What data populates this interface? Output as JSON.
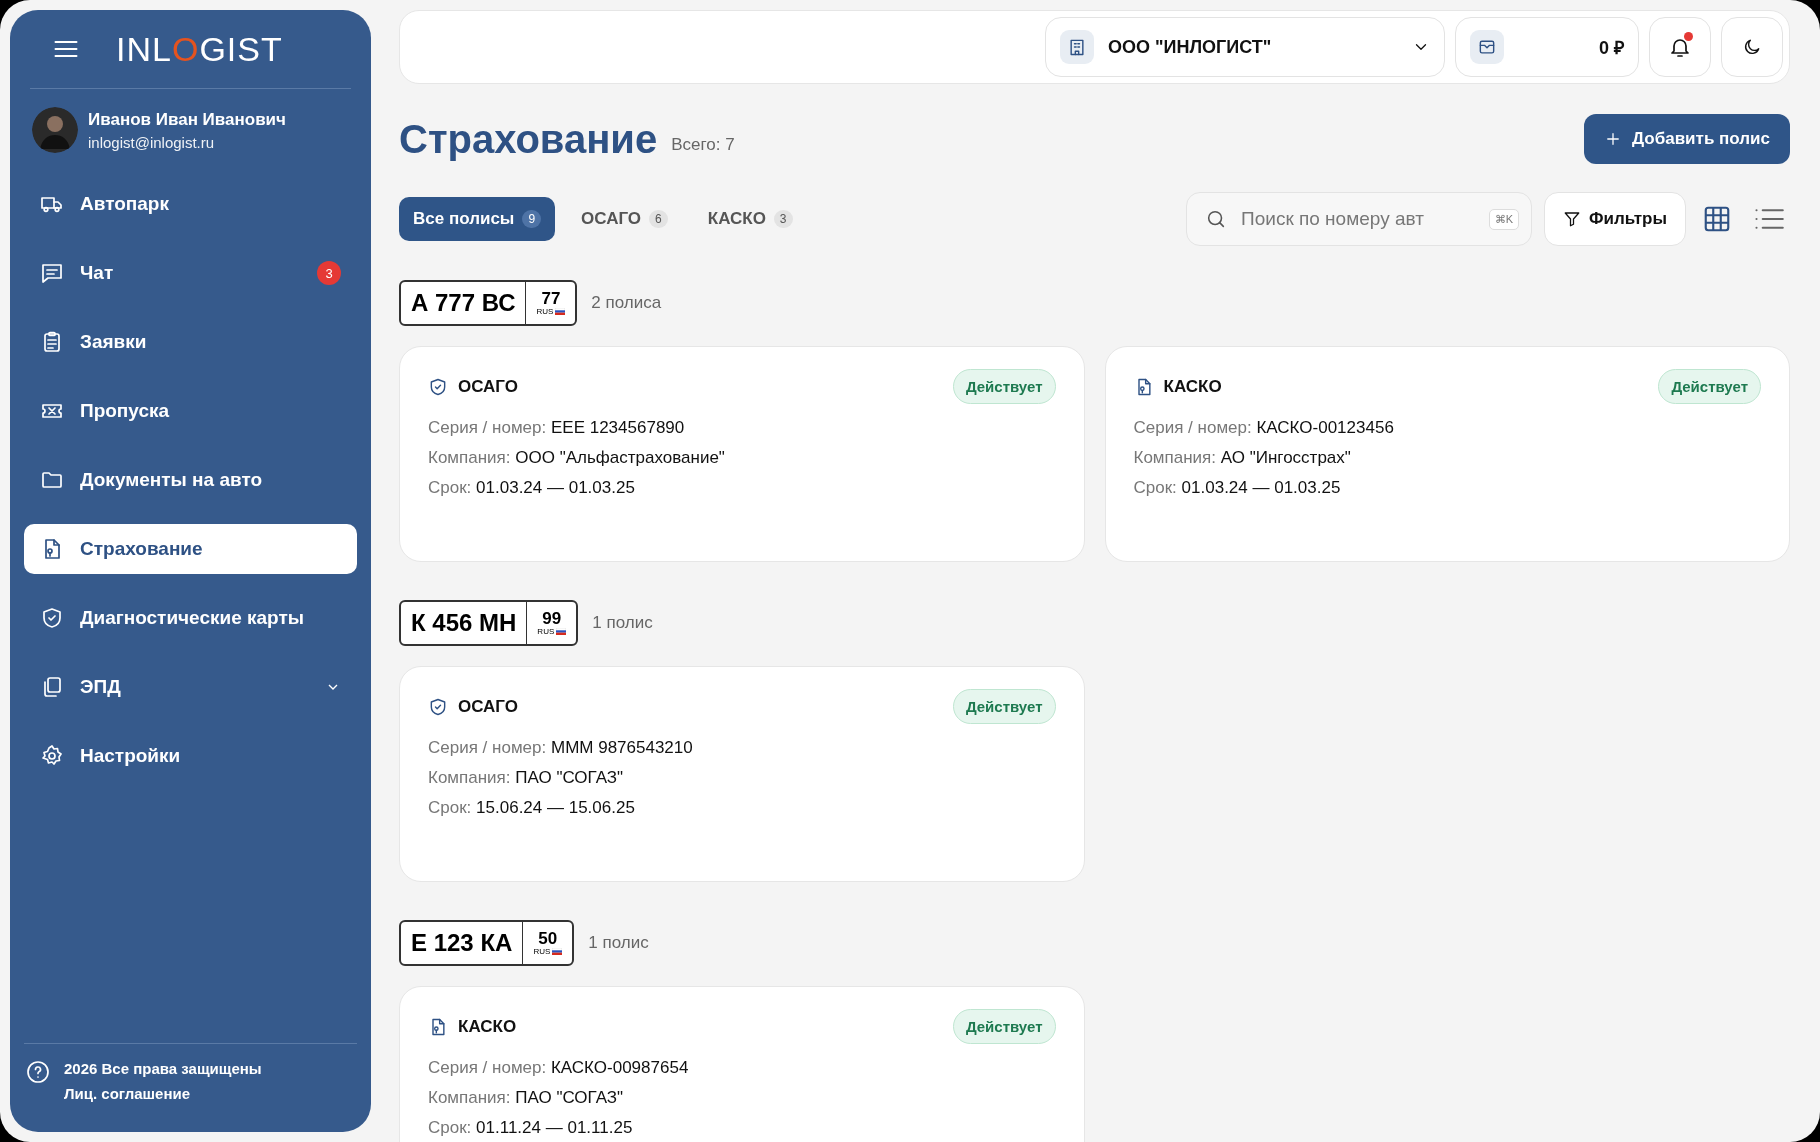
{
  "sidebar": {
    "logo": {
      "before": "INL",
      "accent": "O",
      "after": "GIST"
    },
    "user": {
      "name": "Иванов Иван Иванович",
      "email": "inlogist@inlogist.ru"
    },
    "items": [
      {
        "label": "Автопарк",
        "kind": "truck",
        "selected": false
      },
      {
        "label": "Чат",
        "kind": "chat",
        "selected": false,
        "badge": "3"
      },
      {
        "label": "Заявки",
        "kind": "clipboard",
        "selected": false
      },
      {
        "label": "Пропуска",
        "kind": "ticket",
        "selected": false
      },
      {
        "label": "Документы на авто",
        "kind": "folder",
        "selected": false
      },
      {
        "label": "Страхование",
        "kind": "document",
        "selected": true
      },
      {
        "label": "Диагностические карты",
        "kind": "shield",
        "selected": false
      },
      {
        "label": "ЭПД",
        "kind": "copy",
        "selected": false,
        "expanded": false
      },
      {
        "label": "Настройки",
        "kind": "gear",
        "selected": false
      }
    ],
    "footer": {
      "copyright": "2026 Все права защищены",
      "link": "Лиц. соглашение"
    }
  },
  "topbar": {
    "company": "ООО \"ИНЛОГИСТ\"",
    "balance": "0 ₽",
    "unread": true
  },
  "header": {
    "title": "Страхование",
    "total": "Всего: 7",
    "add_button": "Добавить полис"
  },
  "tabs": [
    {
      "label": "Все полисы",
      "count": "9",
      "selected": true
    },
    {
      "label": "ОСАГО",
      "count": "6",
      "selected": false
    },
    {
      "label": "КАСКО",
      "count": "3",
      "selected": false
    }
  ],
  "search": {
    "placeholder": "Поиск по номеру авт",
    "shortcut": "⌘K"
  },
  "filters_button": "Фильтры",
  "views": [
    {
      "kind": "grid",
      "selected": true
    },
    {
      "kind": "list",
      "selected": false
    }
  ],
  "groups": [
    {
      "plate": {
        "number": "А 777 ВС",
        "region": "77",
        "country": "RUS"
      },
      "count": "2 полиса",
      "policies": [
        {
          "kind": "osago",
          "type": "ОСАГО",
          "status": "Действует",
          "fields": [
            {
              "label": "Серия / номер:",
              "value": "ЕЕЕ 1234567890"
            },
            {
              "label": "Компания:",
              "value": "ООО \"Альфастрахование\""
            },
            {
              "label": "Срок:",
              "value": "01.03.24 — 01.03.25"
            }
          ]
        },
        {
          "kind": "kasko",
          "type": "КАСКО",
          "status": "Действует",
          "fields": [
            {
              "label": "Серия / номер:",
              "value": "КАСКО-00123456"
            },
            {
              "label": "Компания:",
              "value": "АО \"Ингосстрах\""
            },
            {
              "label": "Срок:",
              "value": "01.03.24 — 01.03.25"
            }
          ]
        }
      ]
    },
    {
      "plate": {
        "number": "К 456 МН",
        "region": "99",
        "country": "RUS"
      },
      "count": "1 полис",
      "policies": [
        {
          "kind": "osago",
          "type": "ОСАГО",
          "status": "Действует",
          "fields": [
            {
              "label": "Серия / номер:",
              "value": "МММ 9876543210"
            },
            {
              "label": "Компания:",
              "value": "ПАО \"СОГАЗ\""
            },
            {
              "label": "Срок:",
              "value": "15.06.24 — 15.06.25"
            }
          ]
        }
      ]
    },
    {
      "plate": {
        "number": "Е 123 КА",
        "region": "50",
        "country": "RUS"
      },
      "count": "1 полис",
      "policies": [
        {
          "kind": "kasko",
          "type": "КАСКО",
          "status": "Действует",
          "fields": [
            {
              "label": "Серия / номер:",
              "value": "КАСКО-00987654"
            },
            {
              "label": "Компания:",
              "value": "ПАО \"СОГАЗ\""
            },
            {
              "label": "Срок:",
              "value": "01.11.24 — 01.11.25"
            }
          ]
        }
      ]
    }
  ]
}
